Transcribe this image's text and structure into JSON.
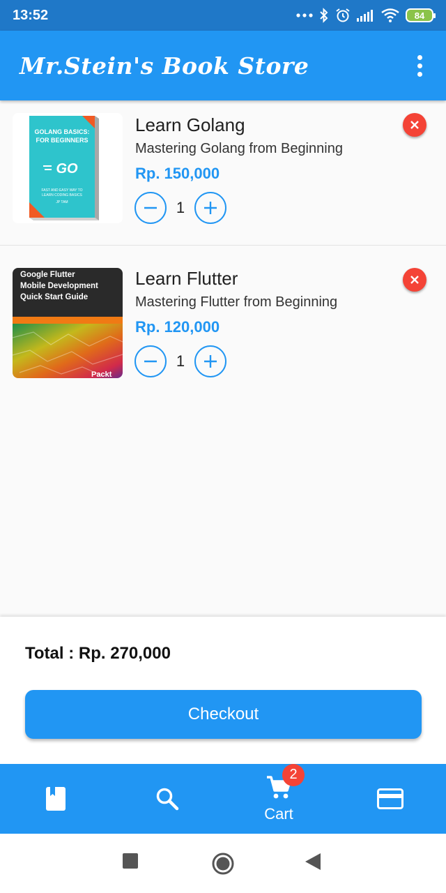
{
  "status_bar": {
    "time": "13:52",
    "battery": "84"
  },
  "app_bar": {
    "title": "Mr.Stein's Book Store",
    "menu_icon": "more-vert-icon"
  },
  "cart_items": [
    {
      "title": "Learn Golang",
      "subtitle": "Mastering Golang from Beginning",
      "price": "Rp. 150,000",
      "quantity": "1",
      "cover": {
        "heading": "GOLANG BASICS: FOR BEGINNERS",
        "logo": "GO",
        "tagline": "FAST AND EASY WAY TO LEARN CODING BASICS",
        "author": "JP TAM",
        "colors": {
          "background": "#2ec4cc",
          "accent": "#f05a24"
        }
      }
    },
    {
      "title": "Learn Flutter",
      "subtitle": "Mastering Flutter from Beginning",
      "price": "Rp. 120,000",
      "quantity": "1",
      "cover": {
        "heading": "Google Flutter Mobile Development Quick Start Guide",
        "publisher": "Packt",
        "colors": {
          "background": "#2a2a2a",
          "accent": "#f07a14"
        }
      }
    }
  ],
  "summary": {
    "total": "Total : Rp. 270,000",
    "checkout_label": "Checkout"
  },
  "bottom_nav": {
    "items": [
      {
        "icon": "book-icon",
        "label": ""
      },
      {
        "icon": "search-icon",
        "label": ""
      },
      {
        "icon": "shopping-cart-icon",
        "label": "Cart",
        "badge": "2"
      },
      {
        "icon": "credit-card-icon",
        "label": ""
      }
    ]
  },
  "system_nav": {
    "icons": [
      "recent-apps-icon",
      "home-icon",
      "back-icon"
    ]
  },
  "colors": {
    "primary": "#2196f3",
    "status_bar": "#1f78c8",
    "danger": "#f44336"
  }
}
